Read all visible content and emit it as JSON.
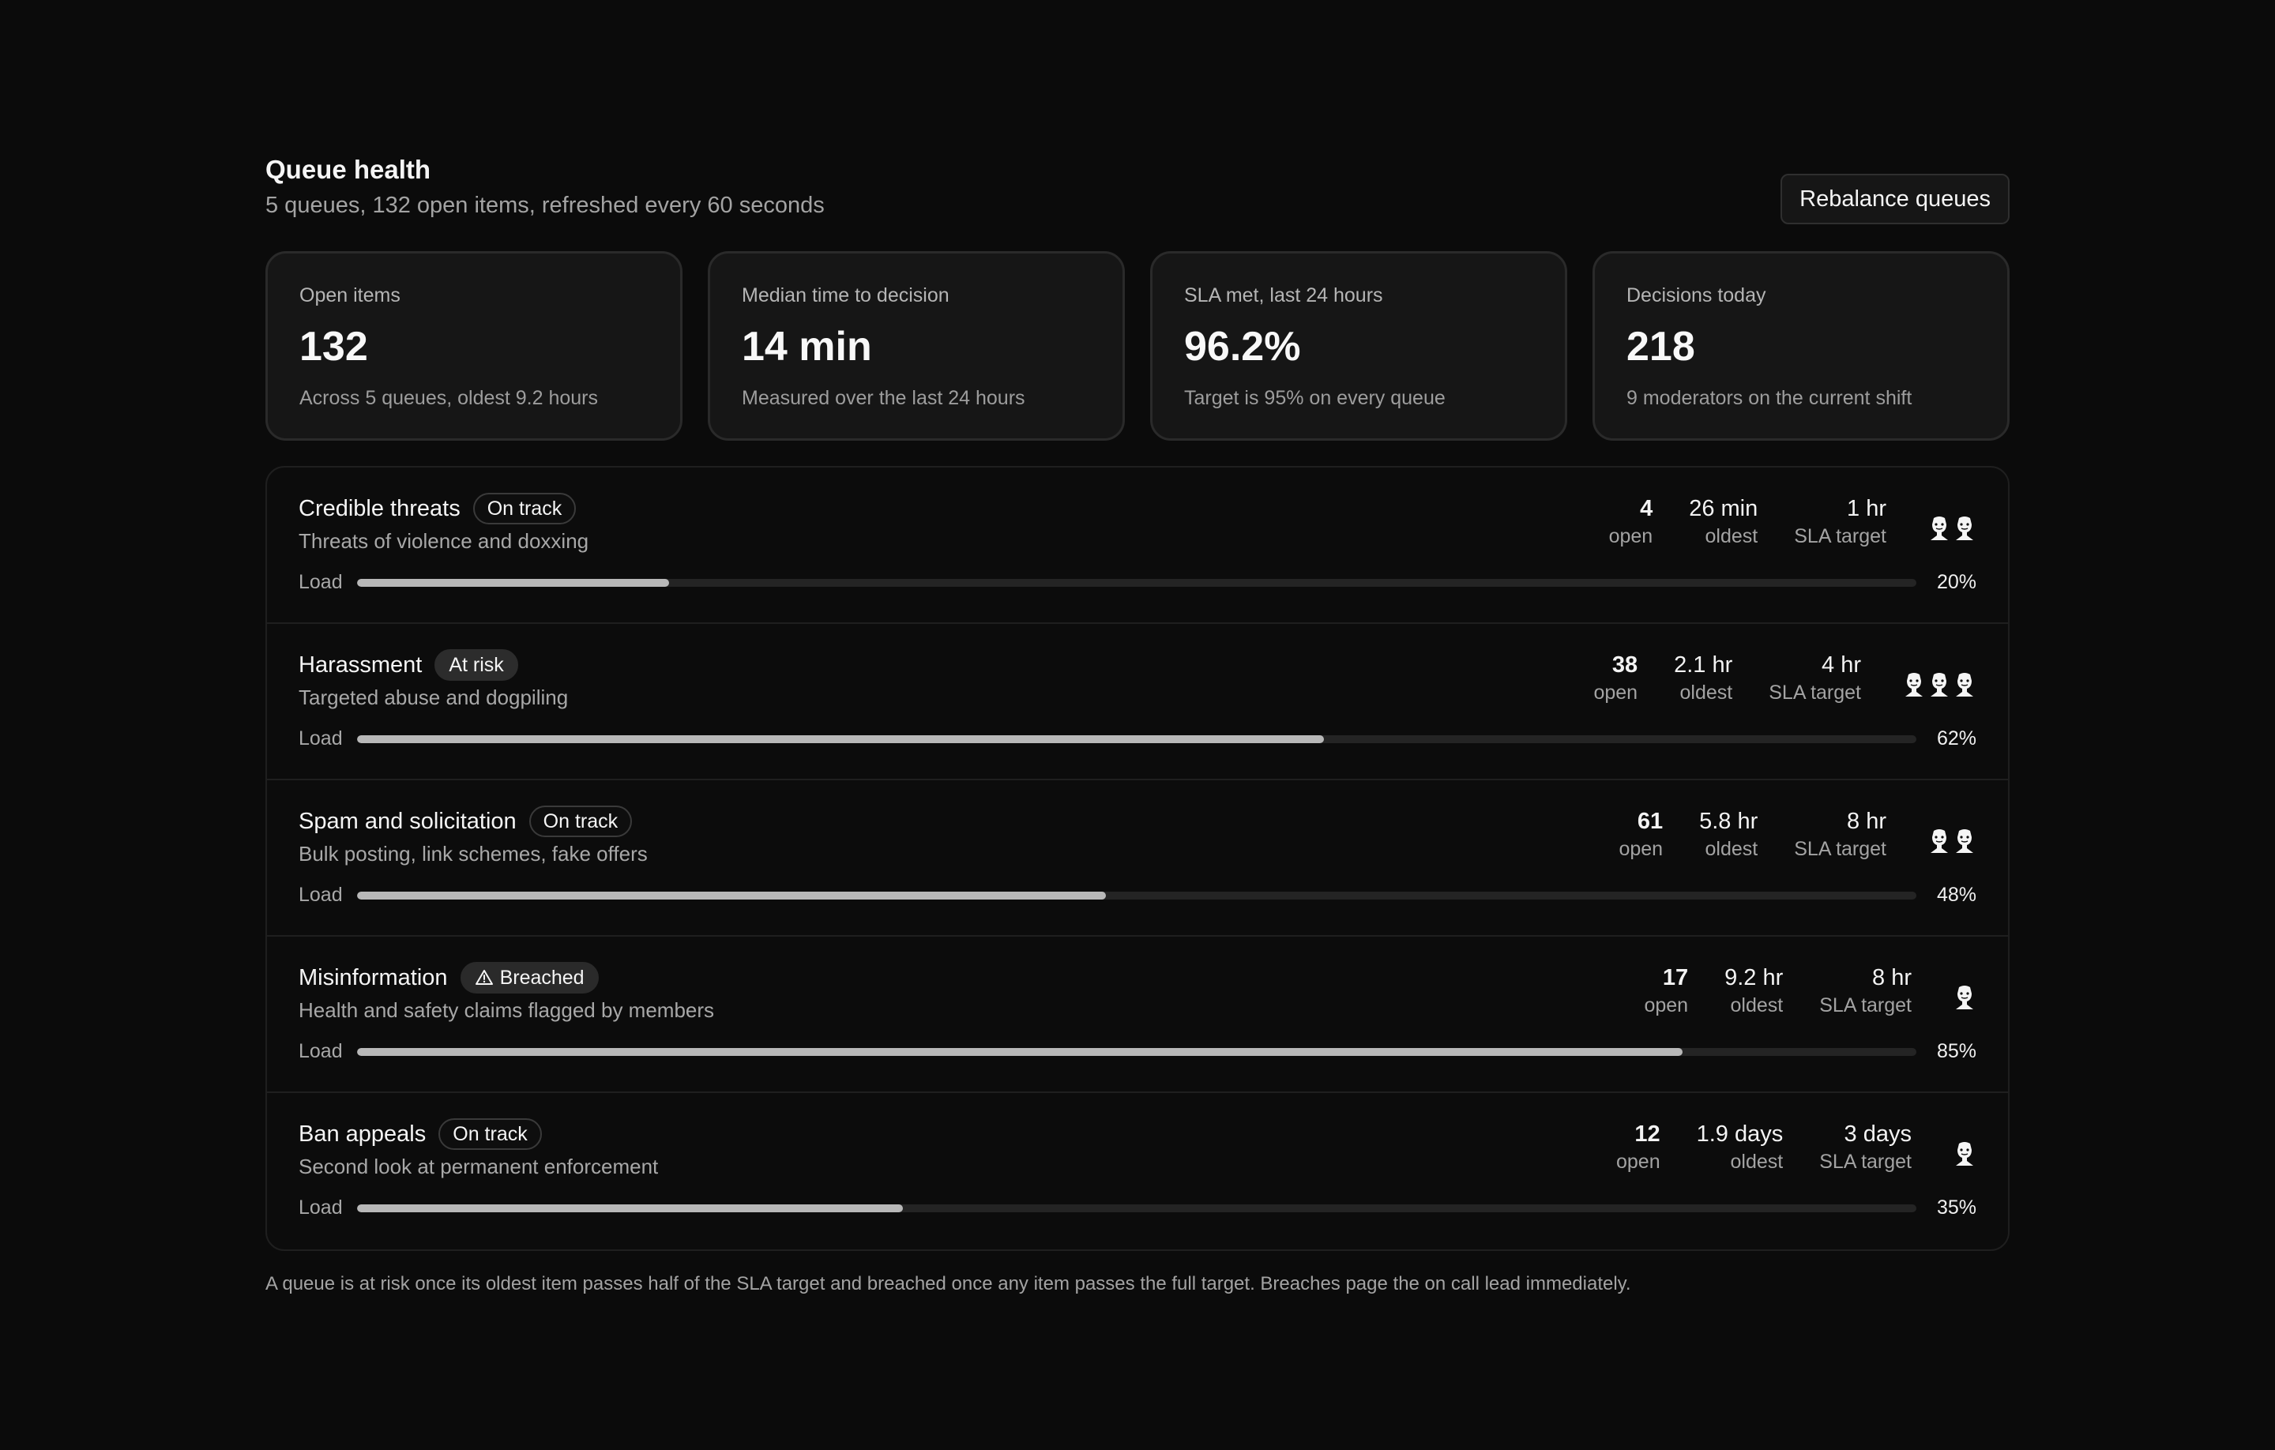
{
  "header": {
    "title": "Queue health",
    "subtitle": "5 queues, 132 open items, refreshed every 60 seconds",
    "rebalance_label": "Rebalance queues"
  },
  "stats": [
    {
      "label": "Open items",
      "value": "132",
      "note": "Across 5 queues, oldest 9.2 hours"
    },
    {
      "label": "Median time to decision",
      "value": "14 min",
      "note": "Measured over the last 24 hours"
    },
    {
      "label": "SLA met, last 24 hours",
      "value": "96.2%",
      "note": "Target is 95% on every queue"
    },
    {
      "label": "Decisions today",
      "value": "218",
      "note": "9 moderators on the current shift"
    }
  ],
  "labels": {
    "open": "open",
    "oldest": "oldest",
    "sla_target": "SLA target",
    "load": "Load"
  },
  "queues": [
    {
      "name": "Credible threats",
      "status": "On track",
      "description": "Threats of violence and doxxing",
      "open": "4",
      "oldest": "26 min",
      "sla_target": "1 hr",
      "load_pct": "20%",
      "load": 0.2,
      "moderators": 2
    },
    {
      "name": "Harassment",
      "status": "At risk",
      "description": "Targeted abuse and dogpiling",
      "open": "38",
      "oldest": "2.1 hr",
      "sla_target": "4 hr",
      "load_pct": "62%",
      "load": 0.62,
      "moderators": 3
    },
    {
      "name": "Spam and solicitation",
      "status": "On track",
      "description": "Bulk posting, link schemes, fake offers",
      "open": "61",
      "oldest": "5.8 hr",
      "sla_target": "8 hr",
      "load_pct": "48%",
      "load": 0.48,
      "moderators": 2
    },
    {
      "name": "Misinformation",
      "status": "Breached",
      "description": "Health and safety claims flagged by members",
      "open": "17",
      "oldest": "9.2 hr",
      "sla_target": "8 hr",
      "load_pct": "85%",
      "load": 0.85,
      "moderators": 1
    },
    {
      "name": "Ban appeals",
      "status": "On track",
      "description": "Second look at permanent enforcement",
      "open": "12",
      "oldest": "1.9 days",
      "sla_target": "3 days",
      "load_pct": "35%",
      "load": 0.35,
      "moderators": 1
    }
  ],
  "footnote": "A queue is at risk once its oldest item passes half of the SLA target and breached once any item passes the full target. Breaches page the on call lead immediately.",
  "colors": {
    "background": "#0b0b0b",
    "card": "#161616",
    "bar_fill": "#b8b8b8",
    "bar_track": "#242424"
  },
  "icons": {
    "moderator": "moderator-avatar-icon",
    "breached": "warning-triangle-icon"
  }
}
